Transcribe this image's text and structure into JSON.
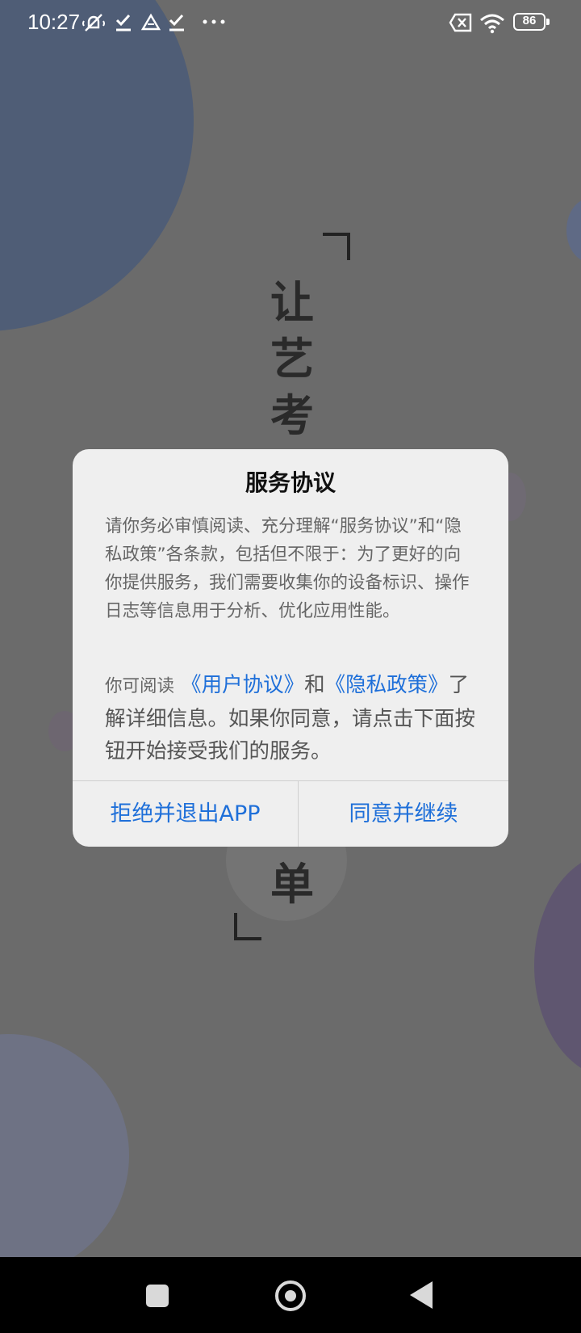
{
  "status_bar": {
    "time": "10:27",
    "battery": "86",
    "icons": [
      "mute-icon",
      "check-icon",
      "drive-icon",
      "check-icon",
      "more-dots-icon",
      "sim-none-icon",
      "wifi-icon",
      "battery-icon"
    ]
  },
  "background": {
    "slogan_chars": [
      "让",
      "艺",
      "考"
    ],
    "slogan_end_char": "单"
  },
  "dialog": {
    "title": "服务协议",
    "body": "请你务必审慎阅读、充分理解“服务协议”和“隐私政策”各条款，包括但不限于：为了更好的向你提供服务，我们需要收集你的设备标识、操作日志等信息用于分析、优化应用性能。",
    "read_prefix": "你可阅读",
    "link_user_agreement": "《用户协议》",
    "and": "和",
    "link_privacy_policy": "《隐私政策》",
    "read_suffix": "了解详细信息。如果你同意，请点击下面按钮开始接受我们的服务。",
    "reject_button": "拒绝并退出APP",
    "agree_button": "同意并继续"
  },
  "colors": {
    "link": "#1e6fd9",
    "dialog_bg": "#efefef",
    "scrim": "#6b6b6b"
  }
}
